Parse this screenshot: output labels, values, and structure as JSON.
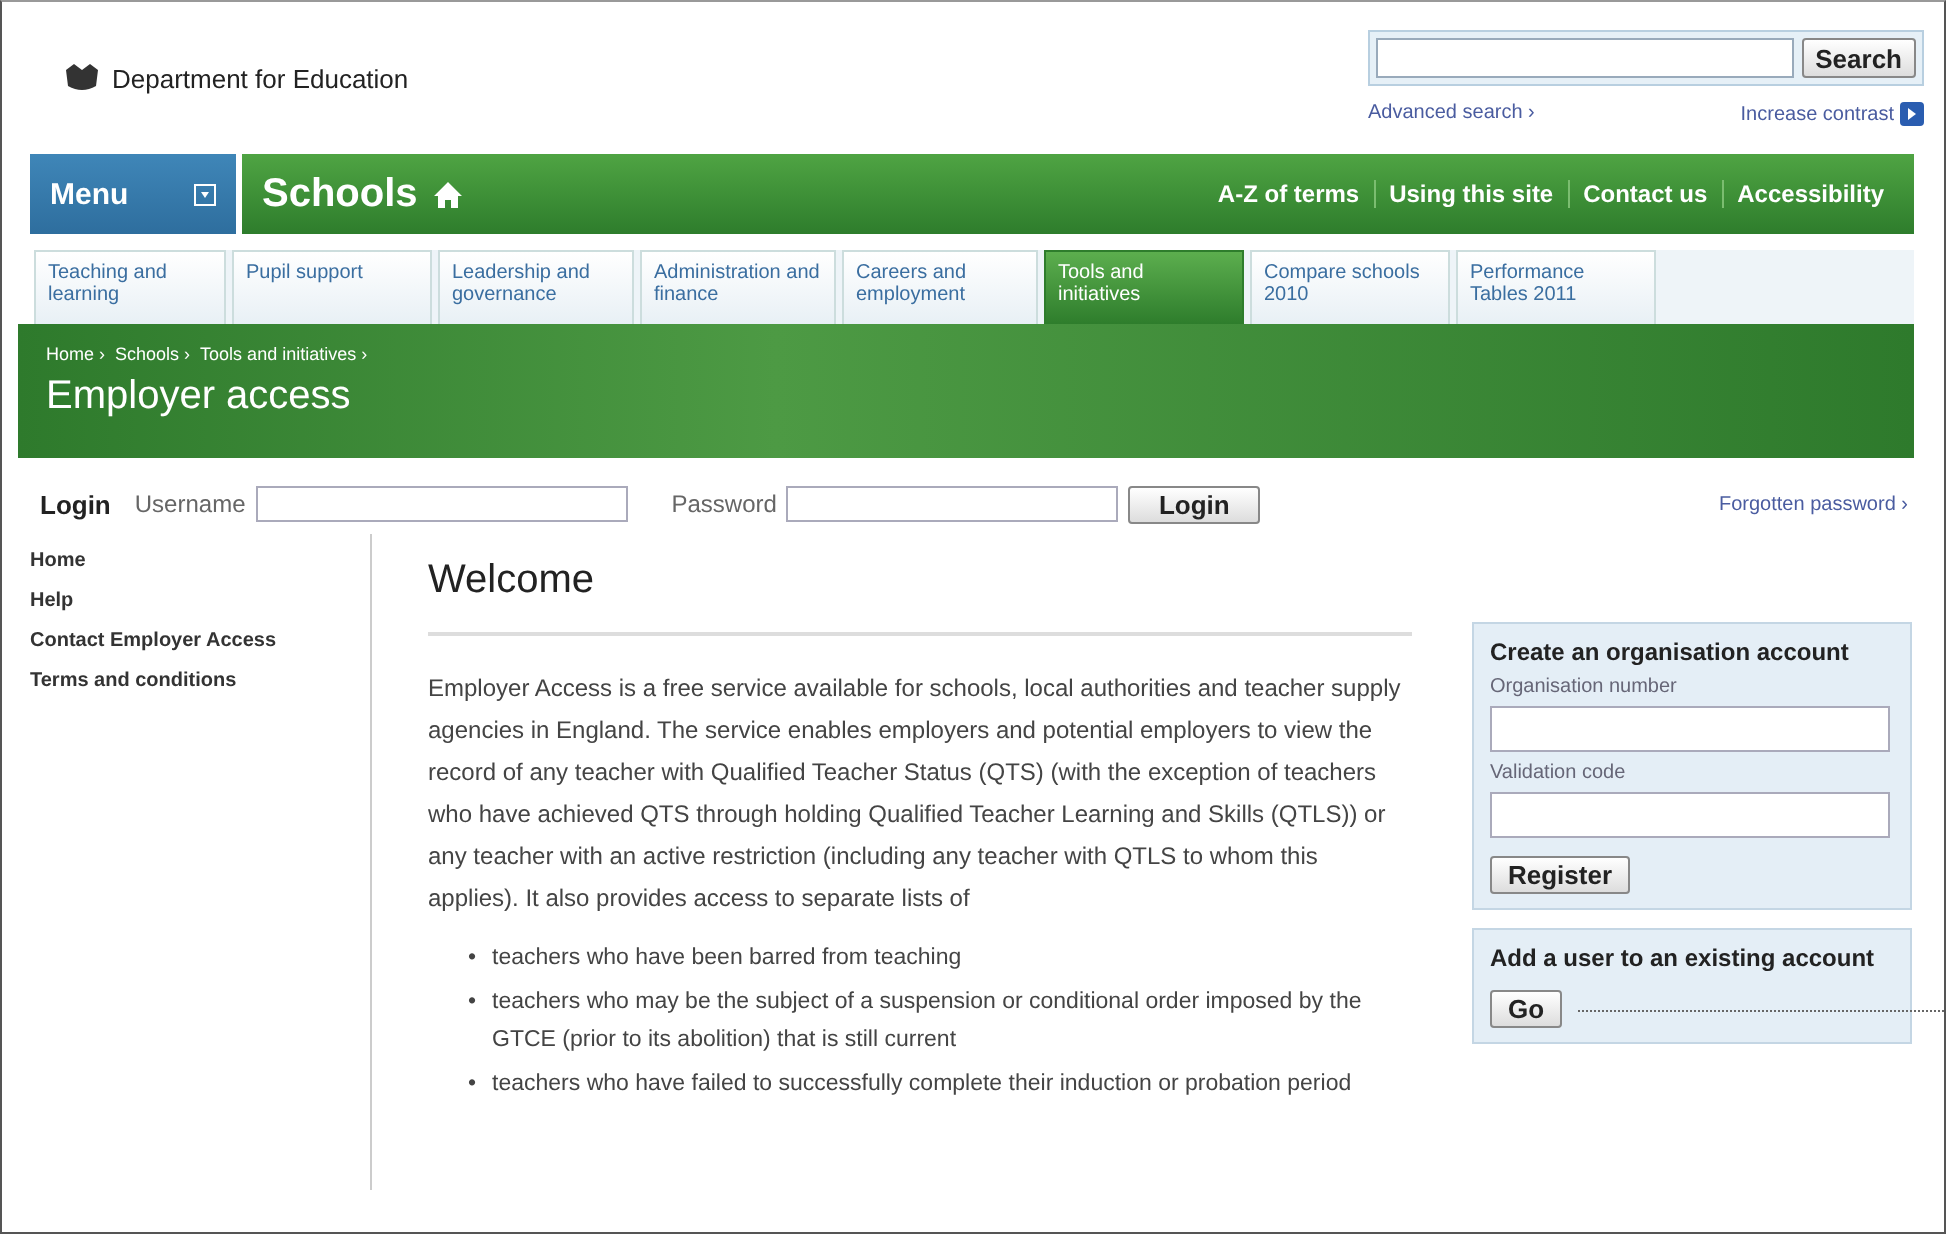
{
  "header": {
    "logo_text": "Department for Education",
    "search_button": "Search",
    "advanced_search": "Advanced search ›",
    "increase_contrast": "Increase contrast"
  },
  "nav": {
    "menu_label": "Menu",
    "section_title": "Schools",
    "links": [
      "A-Z of terms",
      "Using this site",
      "Contact us",
      "Accessibility"
    ]
  },
  "tabs": [
    {
      "label": "Teaching and learning",
      "selected": false
    },
    {
      "label": "Pupil support",
      "selected": false
    },
    {
      "label": "Leadership and governance",
      "selected": false
    },
    {
      "label": "Administration and finance",
      "selected": false
    },
    {
      "label": "Careers and employment",
      "selected": false
    },
    {
      "label": "Tools and initiatives",
      "selected": true
    },
    {
      "label": "Compare schools 2010",
      "selected": false
    },
    {
      "label": "Performance Tables 2011",
      "selected": false
    }
  ],
  "breadcrumb": [
    "Home ›",
    "Schools ›",
    "Tools and initiatives ›"
  ],
  "page_title": "Employer access",
  "login": {
    "label": "Login",
    "username_label": "Username",
    "password_label": "Password",
    "button": "Login",
    "forgotten": "Forgotten password ›"
  },
  "sidebar": {
    "items": [
      "Home",
      "Help",
      "Contact Employer Access",
      "Terms and conditions"
    ]
  },
  "content": {
    "heading": "Welcome",
    "paragraph": "Employer Access is a free service available for schools, local authorities and teacher supply agencies in England. The service enables employers and potential employers to view the record of any teacher with Qualified Teacher Status (QTS) (with the exception of teachers who have achieved QTS through holding Qualified Teacher Learning and Skills (QTLS)) or any teacher with an active restriction (including any teacher with QTLS to whom this applies). It also provides access to separate lists of",
    "bullets": [
      {
        "marker": "•",
        "text": "teachers who have been barred from teaching"
      },
      {
        "marker": "•",
        "text": "teachers who may be the subject of a suspension or conditional order imposed by the GTCE (prior to its abolition) that is still current"
      },
      {
        "marker": "•",
        "text": "teachers who have failed to successfully complete their induction or probation period"
      }
    ]
  },
  "panels": {
    "create": {
      "title": "Create an organisation account",
      "fields": [
        {
          "label": "Organisation number"
        },
        {
          "label": "Validation code"
        }
      ],
      "button": "Register"
    },
    "add_user": {
      "title": "Add a user to an existing account",
      "button": "Go"
    }
  }
}
